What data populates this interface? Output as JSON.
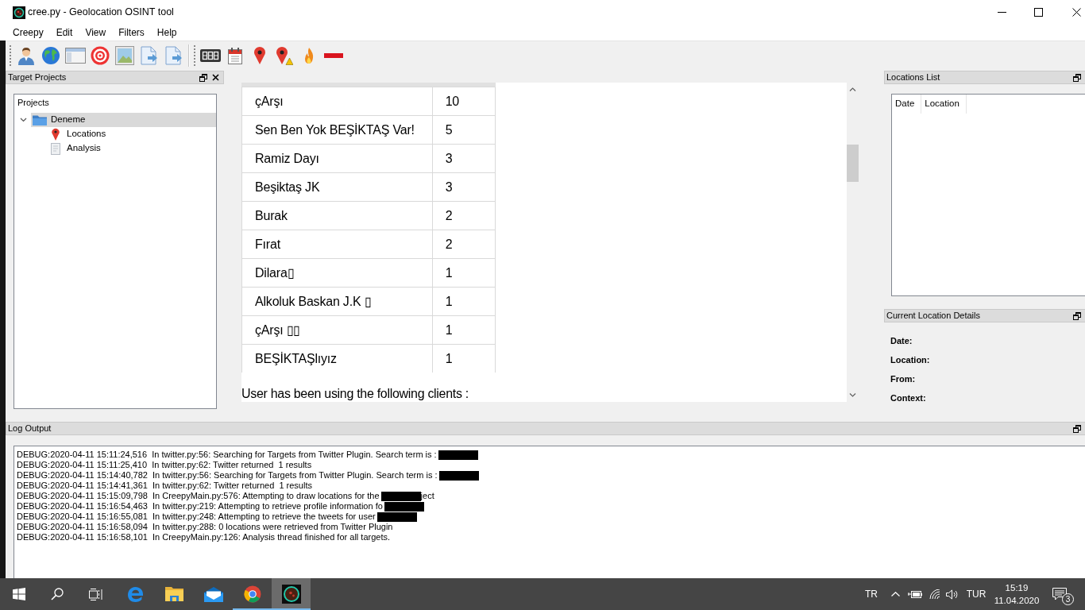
{
  "window": {
    "title": "cree.py - Geolocation OSINT tool"
  },
  "menu": [
    "Creepy",
    "Edit",
    "View",
    "Filters",
    "Help"
  ],
  "target_projects": {
    "title": "Target Projects",
    "tree": {
      "header": "Projects",
      "items": [
        {
          "label": "Deneme",
          "kind": "project",
          "expanded": true,
          "selected": true,
          "children": [
            {
              "label": "Locations",
              "kind": "locations",
              "selected": false
            },
            {
              "label": "Analysis",
              "kind": "analysis",
              "selected": false
            }
          ]
        }
      ]
    }
  },
  "analysis": {
    "table": {
      "rows": [
        [
          "çArşı",
          "10"
        ],
        [
          "Sen Ben Yok BEŞİKTAŞ Var!",
          "5"
        ],
        [
          "Ramiz Dayı",
          "3"
        ],
        [
          "Beşiktaş JK",
          "3"
        ],
        [
          "Burak",
          "2"
        ],
        [
          "Fırat",
          "2"
        ],
        [
          "Dilara▯",
          "1"
        ],
        [
          "Alkoluk Baskan J.K ▯",
          "1"
        ],
        [
          "çArşı ▯▯",
          "1"
        ],
        [
          "BEŞİKTAŞlıyız",
          "1"
        ]
      ]
    },
    "clients_heading": "User has been using the following clients :"
  },
  "locations_list": {
    "title": "Locations List",
    "columns": [
      "Date",
      "Location"
    ]
  },
  "location_details": {
    "title": "Current Location Details",
    "fields": [
      "Date:",
      "Location:",
      "From:",
      "Context:"
    ]
  },
  "log_output": {
    "title": "Log Output",
    "lines": [
      [
        {
          "kind": "text",
          "text": "DEBUG:2020-04-11 15:11:24,516  In twitter.py:56: Searching for Targets from Twitter Plugin. Search term is :"
        },
        {
          "kind": "redaction"
        }
      ],
      [
        {
          "kind": "text",
          "text": "DEBUG:2020-04-11 15:11:25,410  In twitter.py:62: Twitter returned  1 results"
        }
      ],
      [
        {
          "kind": "text",
          "text": "DEBUG:2020-04-11 15:14:40,782  In twitter.py:56: Searching for Targets from Twitter Plugin. Search term is :"
        },
        {
          "kind": "redaction"
        }
      ],
      [
        {
          "kind": "text",
          "text": "DEBUG:2020-04-11 15:14:41,361  In twitter.py:62: Twitter returned  1 results"
        }
      ],
      [
        {
          "kind": "text",
          "text": "DEBUG:2020-04-11 15:15:09,798  In CreepyMain.py:576: Attempting to draw locations for the"
        },
        {
          "kind": "redaction"
        },
        {
          "kind": "text",
          "text": "ject"
        }
      ],
      [
        {
          "kind": "text",
          "text": "DEBUG:2020-04-11 15:16:54,463  In twitter.py:219: Attempting to retrieve profile information fo"
        },
        {
          "kind": "redaction"
        }
      ],
      [
        {
          "kind": "text",
          "text": "DEBUG:2020-04-11 15:16:55,081  In twitter.py:248: Attempting to retrieve the tweets for user"
        },
        {
          "kind": "redaction"
        }
      ],
      [
        {
          "kind": "text",
          "text": "DEBUG:2020-04-11 15:16:58,094  In twitter.py:288: 0 locations were retrieved from Twitter Plugin"
        }
      ],
      [
        {
          "kind": "text",
          "text": "DEBUG:2020-04-11 15:16:58,101  In CreepyMain.py:126: Analysis thread finished for all targets."
        }
      ]
    ]
  },
  "taskbar": {
    "apps": [
      {
        "selected": false,
        "running": false
      },
      {
        "selected": false,
        "running": false
      },
      {
        "selected": false,
        "running": false
      },
      {
        "selected": false,
        "running": true
      },
      {
        "selected": true,
        "running": true
      }
    ],
    "language": "TR",
    "input_method": "TUR",
    "time": "15:19",
    "date": "11.04.2020",
    "notification_count": "3"
  }
}
